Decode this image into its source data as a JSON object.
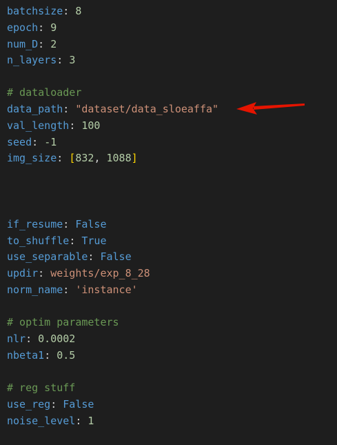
{
  "lines": {
    "batchsize": {
      "key": "batchsize",
      "sep": ": ",
      "value": "8"
    },
    "epoch": {
      "key": "epoch",
      "sep": ": ",
      "value": "9"
    },
    "num_D": {
      "key": "num_D",
      "sep": ": ",
      "value": "2"
    },
    "n_layers": {
      "key": "n_layers",
      "sep": ": ",
      "value": "3"
    },
    "comment_dataloader": "# dataloader",
    "data_path": {
      "key": "data_path",
      "sep": ": ",
      "value": "\"dataset/data_sloeaffa\""
    },
    "val_length": {
      "key": "val_length",
      "sep": ": ",
      "value": "100"
    },
    "seed": {
      "key": "seed",
      "sep": ": ",
      "value": "-1"
    },
    "img_size": {
      "key": "img_size",
      "sep": ": ",
      "open": "[",
      "v1": "832",
      "comma": ", ",
      "v2": "1088",
      "close": "]"
    },
    "if_resume": {
      "key": "if_resume",
      "sep": ": ",
      "value": "False"
    },
    "to_shuffle": {
      "key": "to_shuffle",
      "sep": ": ",
      "value": "True"
    },
    "use_separable": {
      "key": "use_separable",
      "sep": ": ",
      "value": "False"
    },
    "updir": {
      "key": "updir",
      "sep": ": ",
      "value": "weights/exp_8_28"
    },
    "norm_name": {
      "key": "norm_name",
      "sep": ": ",
      "value": "'instance'"
    },
    "comment_optim": "# optim parameters",
    "nlr": {
      "key": "nlr",
      "sep": ": ",
      "value": "0.0002"
    },
    "nbeta1": {
      "key": "nbeta1",
      "sep": ": ",
      "value": "0.5"
    },
    "comment_reg": "# reg stuff",
    "use_reg": {
      "key": "use_reg",
      "sep": ": ",
      "value": "False"
    },
    "noise_level": {
      "key": "noise_level",
      "sep": ": ",
      "value": "1"
    }
  },
  "colors": {
    "background": "#1e1e1e",
    "key": "#569cd6",
    "number": "#b5cea8",
    "string": "#ce9178",
    "comment": "#6a9955",
    "bracket": "#ffd700",
    "annotation_arrow": "#e51400"
  },
  "annotation": {
    "icon": "red-arrow-icon",
    "points_to": "data_path"
  }
}
